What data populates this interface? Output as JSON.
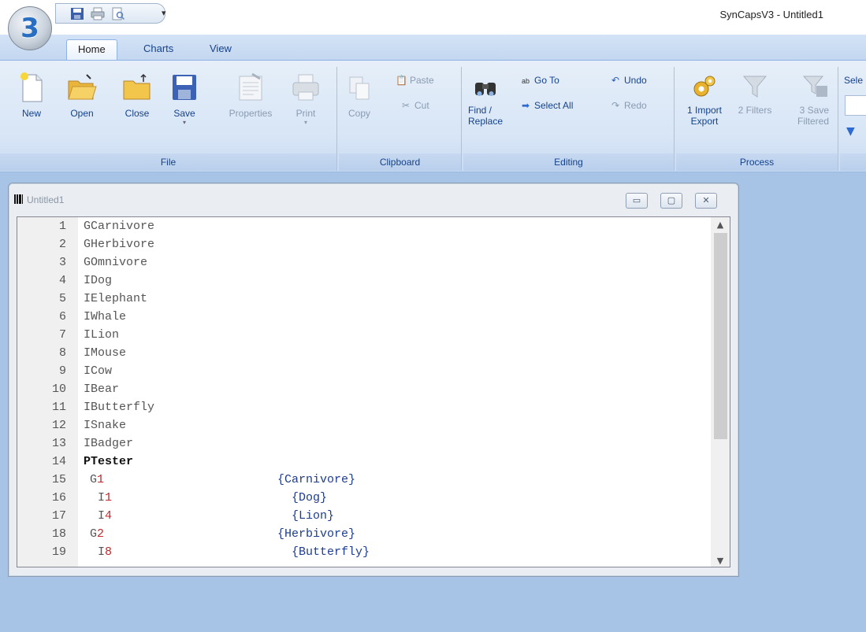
{
  "app": {
    "title": "SynCapsV3 - Untitled1",
    "orb_label": "3"
  },
  "qat": {
    "dropdown_glyph": "▾"
  },
  "tabs": [
    {
      "label": "Home",
      "active": true
    },
    {
      "label": "Charts",
      "active": false
    },
    {
      "label": "View",
      "active": false
    }
  ],
  "ribbon": {
    "file": {
      "label": "File",
      "new": "New",
      "open": "Open",
      "close": "Close",
      "save": "Save",
      "properties": "Properties",
      "print": "Print"
    },
    "clipboard": {
      "label": "Clipboard",
      "copy": "Copy",
      "paste": "Paste",
      "cut": "Cut"
    },
    "editing": {
      "label": "Editing",
      "find_line1": "Find /",
      "find_line2": "Replace",
      "goto": "Go To",
      "select_all": "Select All",
      "undo": "Undo",
      "redo": "Redo"
    },
    "process": {
      "label": "Process",
      "import_line1": "1 Import",
      "import_line2": "Export",
      "filters": "2 Filters",
      "save_line1": "3 Save",
      "save_line2": "Filtered"
    },
    "partial": {
      "label": "Sele"
    }
  },
  "document": {
    "title": "Untitled1",
    "lines": [
      {
        "n": "1",
        "text": "GCarnivore"
      },
      {
        "n": "2",
        "text": "GHerbivore"
      },
      {
        "n": "3",
        "text": "GOmnivore"
      },
      {
        "n": "4",
        "text": "IDog"
      },
      {
        "n": "5",
        "text": "IElephant"
      },
      {
        "n": "6",
        "text": "IWhale"
      },
      {
        "n": "7",
        "text": "ILion"
      },
      {
        "n": "8",
        "text": "IMouse"
      },
      {
        "n": "9",
        "text": "ICow"
      },
      {
        "n": "10",
        "text": "IBear"
      },
      {
        "n": "11",
        "text": "IButterfly"
      },
      {
        "n": "12",
        "text": "ISnake"
      },
      {
        "n": "13",
        "text": "IBadger"
      },
      {
        "n": "14",
        "text": "PTester"
      },
      {
        "n": "15",
        "prefix": "G",
        "num": "1",
        "brace": "{Carnivore}"
      },
      {
        "n": "16",
        "prefix": "I",
        "num": "1",
        "brace": "{Dog}"
      },
      {
        "n": "17",
        "prefix": "I",
        "num": "4",
        "brace": "{Lion}"
      },
      {
        "n": "18",
        "prefix": "G",
        "num": "2",
        "brace": "{Herbivore}"
      },
      {
        "n": "19",
        "prefix": "I",
        "num": "8",
        "brace": "{Butterfly}"
      }
    ]
  },
  "colors": {
    "ribbon_text": "#15428b",
    "code_number_red": "#c0282d",
    "brace_blue": "#1e3c8c",
    "workspace": "#a7c4e7"
  }
}
